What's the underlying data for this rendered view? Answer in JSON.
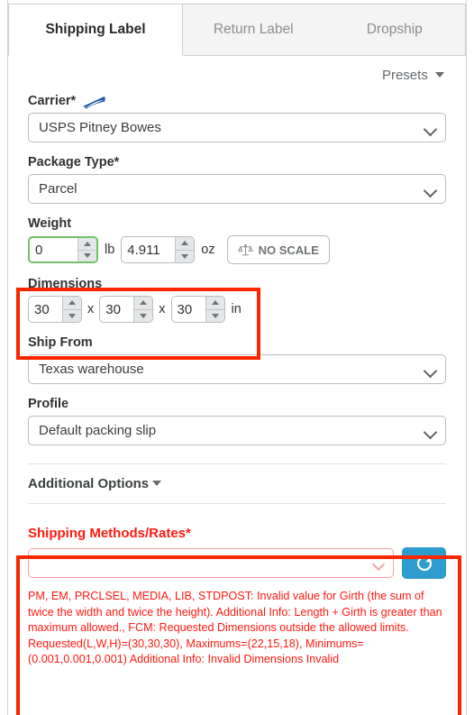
{
  "tabs": [
    {
      "label": "Shipping Label",
      "active": true
    },
    {
      "label": "Return Label",
      "active": false
    },
    {
      "label": "Dropship",
      "active": false
    }
  ],
  "presets": {
    "label": "Presets"
  },
  "carrier": {
    "label": "Carrier*",
    "logo": "usps-eagle-logo",
    "value": "USPS Pitney Bowes"
  },
  "package_type": {
    "label": "Package Type*",
    "value": "Parcel"
  },
  "weight": {
    "label": "Weight",
    "lb_value": "0",
    "lb_unit": "lb",
    "oz_value": "4.911",
    "oz_unit": "oz",
    "scale_button": "NO SCALE",
    "scale_icon": "balance-scale-icon"
  },
  "dimensions": {
    "label": "Dimensions",
    "length": "30",
    "width": "30",
    "height": "30",
    "separator": "x",
    "unit": "in"
  },
  "ship_from": {
    "label": "Ship From",
    "value": "Texas warehouse"
  },
  "profile": {
    "label": "Profile",
    "value": "Default packing slip"
  },
  "additional_options": {
    "label": "Additional Options"
  },
  "shipping_methods": {
    "label": "Shipping Methods/Rates*",
    "value": "",
    "placeholder": "",
    "refresh_icon": "refresh-icon",
    "error": "PM, EM, PRCLSEL, MEDIA, LIB, STDPOST: Invalid value for Girth (the sum of twice the width and twice the height). Additional Info: Length + Girth is greater than maximum allowed., FCM: Requested Dimensions outside the allowed limits. Requested(L,W,H)=(30,30,30), Maximums=(22,15,18), Minimums=(0.001,0.001,0.001) Additional Info: Invalid Dimensions Invalid"
  },
  "colors": {
    "annotation_red": "#fb2600",
    "error_red": "#ff1a0f",
    "refresh_blue": "#2e9ccd",
    "focus_green": "#73c268",
    "usps_blue": "#17509e"
  }
}
